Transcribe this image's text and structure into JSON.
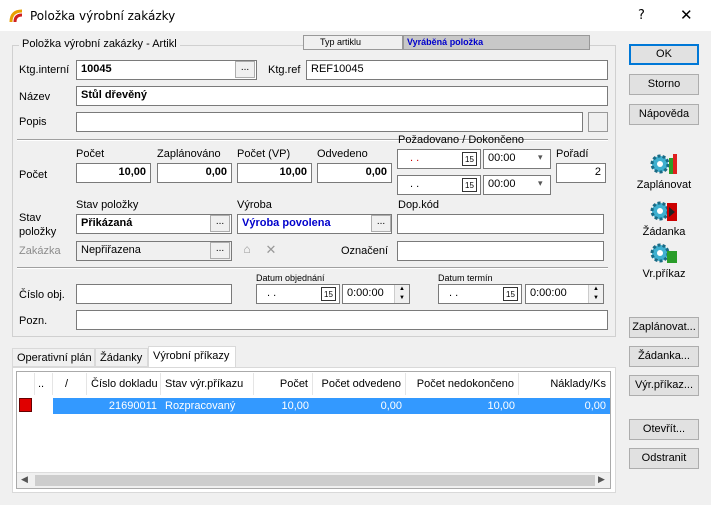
{
  "window": {
    "title": "Položka výrobní zakázky",
    "help": "?",
    "close": "✕"
  },
  "header": {
    "group_title": "Položka výrobní zakázky - Artikl",
    "type_label": "Typ artiklu",
    "type_value": "Vyráběná položka"
  },
  "fields": {
    "ktg_interni_label": "Ktg.interní",
    "ktg_interni": "10045",
    "ellipsis": "...",
    "ktg_ref_label": "Ktg.ref",
    "ktg_ref": "REF10045",
    "nazev_label": "Název",
    "nazev": "Stůl dřevěný",
    "popis_label": "Popis",
    "popis": ""
  },
  "pocet": {
    "row_label": "Počet",
    "pocet_label": "Počet",
    "pocet": "10,00",
    "zaplanovano_label": "Zaplánováno",
    "zaplanovano": "0,00",
    "pocet_vp_label": "Počet (VP)",
    "pocet_vp": "10,00",
    "odvedeno_label": "Odvedeno",
    "odvedeno": "0,00",
    "pozadovano_label": "Požadovano / Dokončeno",
    "date1": ". .",
    "time1": "00:00",
    "date2": ". .",
    "time2": "00:00",
    "poradi_label": "Pořadí",
    "poradi": "2",
    "cal": "15"
  },
  "stav": {
    "label_line1": "Stav",
    "label_line2": "položky",
    "stav_polozky_label": "Stav položky",
    "stav_polozky": "Přikázaná",
    "vyroba_label": "Výroba",
    "vyroba": "Výroba povolena",
    "dop_kod_label": "Dop.kód",
    "dop_kod": "",
    "zakazka_label": "Zakázka",
    "zakazka": "Nepřiřazena",
    "oznaceni_label": "Označení",
    "oznaceni": ""
  },
  "order": {
    "cislo_obj_label": "Číslo obj.",
    "cislo_obj": "",
    "datum_obj_label": "Datum objednání",
    "datum_obj": ". .",
    "datum_obj_time": "0:00:00",
    "datum_termin_label": "Datum termín",
    "datum_termin": ". .",
    "datum_termin_time": "0:00:00",
    "pozn_label": "Pozn.",
    "pozn": ""
  },
  "tabs": [
    "Operativní plán",
    "Žádanky",
    "Výrobní příkazy"
  ],
  "table": {
    "headers": [
      "..",
      "/",
      "Číslo dokladu",
      "Stav výr.příkazu",
      "Počet",
      "Počet odvedeno",
      "Počet nedokončeno",
      "Náklady/Ks"
    ],
    "rows": [
      [
        "",
        "",
        "21690011",
        "Rozpracovaný",
        "10,00",
        "0,00",
        "10,00",
        "0,00"
      ]
    ]
  },
  "buttons": {
    "ok": "OK",
    "storno": "Storno",
    "napoveda": "Nápověda",
    "zaplanovat_dots": "Zaplánovat...",
    "zadanka_dots": "Žádanka...",
    "vyr_prikaz_dots": "Výr.příkaz...",
    "otevrit": "Otevřít...",
    "odstranit": "Odstranit"
  },
  "side_icons": {
    "zaplanovat": "Zaplánovat",
    "zadanka": "Žádanka",
    "vr_prikaz": "Vr.příkaz"
  },
  "colors": {
    "selection": "#3399ff",
    "accent_blue": "#0000cc",
    "type_bg": "#c8c8c8"
  }
}
